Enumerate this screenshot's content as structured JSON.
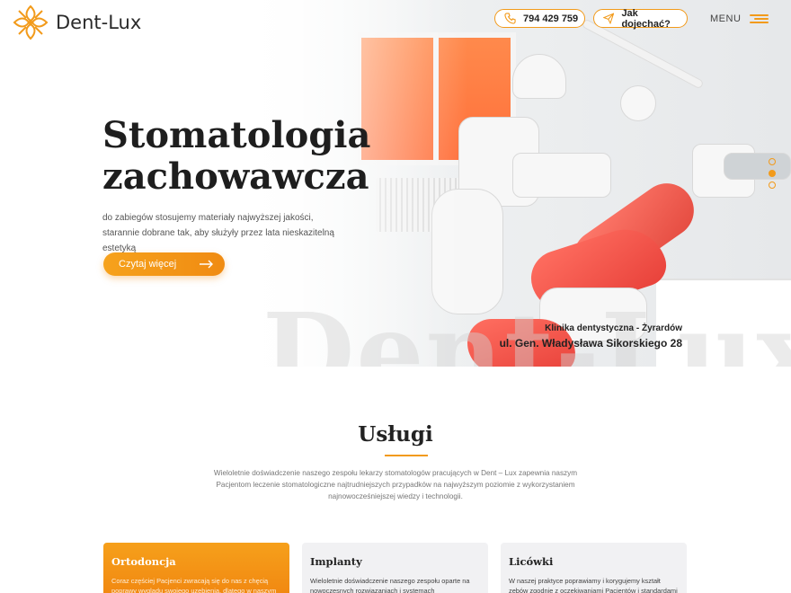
{
  "header": {
    "logo_text": "Dent-Lux",
    "phone": "794 429 759",
    "directions": "Jak dojechać?",
    "menu_label": "MENU"
  },
  "hero": {
    "title": "Stomatologia zachowawcza",
    "description": "do zabiegów stosujemy materiały najwyższej jakości, starannie dobrane tak, aby służyły przez lata nieskazitelną estetyką",
    "cta_label": "Czytaj więcej",
    "clinic_name": "Klinika dentystyczna - Żyrardów",
    "clinic_address": "ul. Gen. Władysława Sikorskiego 28",
    "watermark": "Dent-Lux",
    "slides": {
      "count": 3,
      "active": 2
    }
  },
  "services": {
    "title": "Usługi",
    "description": "Wieloletnie doświadczenie naszego zespołu lekarzy stomatologów pracujących w Dent – Lux zapewnia naszym Pacjentom leczenie stomatologiczne najtrudniejszych przypadków na najwyższym poziomie z wykorzystaniem najnowocześniejszej wiedzy i technologii.",
    "cards": [
      {
        "title": "Ortodoncja",
        "text": "Coraz częściej Pacjenci zwracają się do nas z chęcią poprawy wyglądu swojego uzębienia, dlatego w naszym"
      },
      {
        "title": "Implanty",
        "text": "Wieloletnie doświadczenie naszego zespołu oparte na nowoczesnych rozwiązaniach i systemach"
      },
      {
        "title": "Licówki",
        "text": "W naszej praktyce poprawiamy i korygujemy kształt zębów zgodnie z oczekiwaniami Pacjentów i standardami"
      }
    ]
  },
  "colors": {
    "accent": "#f29a1a",
    "card_active": "#f08b12",
    "card_bg": "#f1f1f3"
  },
  "icons": [
    "logo-mark-icon",
    "phone-icon",
    "paper-plane-icon",
    "hamburger-icon",
    "arrow-right-icon"
  ]
}
